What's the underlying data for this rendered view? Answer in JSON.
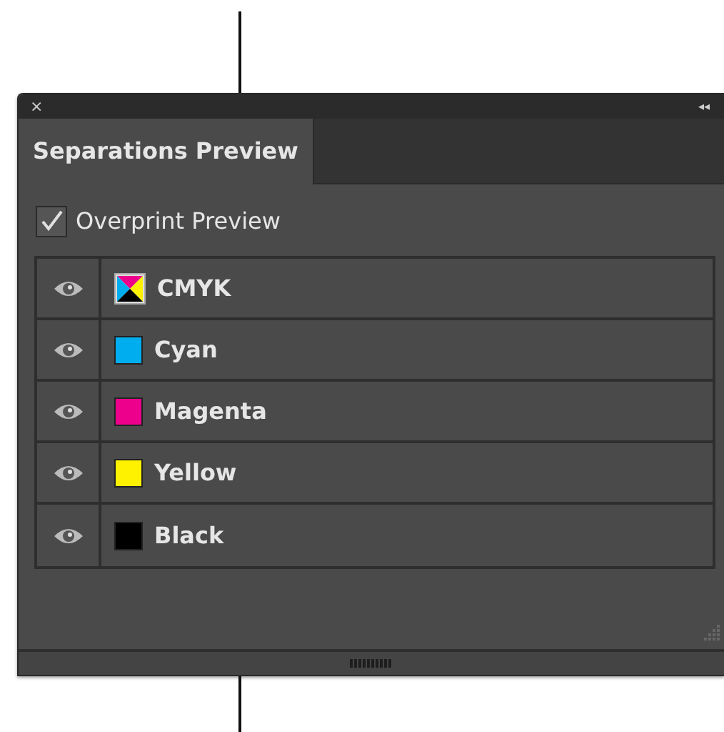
{
  "panel": {
    "close": "×",
    "collapse": "◂◂"
  },
  "tabs": [
    {
      "label": "Separations Preview",
      "selected": true
    }
  ],
  "overprint_preview": {
    "label": "Overprint Preview",
    "checked": true
  },
  "inks": [
    {
      "name": "CMYK",
      "kind": "composite",
      "visible": true
    },
    {
      "name": "Cyan",
      "kind": "swatch",
      "color": "#00aeef",
      "visible": true
    },
    {
      "name": "Magenta",
      "kind": "swatch",
      "color": "#ec008c",
      "visible": true
    },
    {
      "name": "Yellow",
      "kind": "swatch",
      "color": "#fff200",
      "visible": true
    },
    {
      "name": "Black",
      "kind": "swatch",
      "color": "#000000",
      "visible": true
    }
  ]
}
